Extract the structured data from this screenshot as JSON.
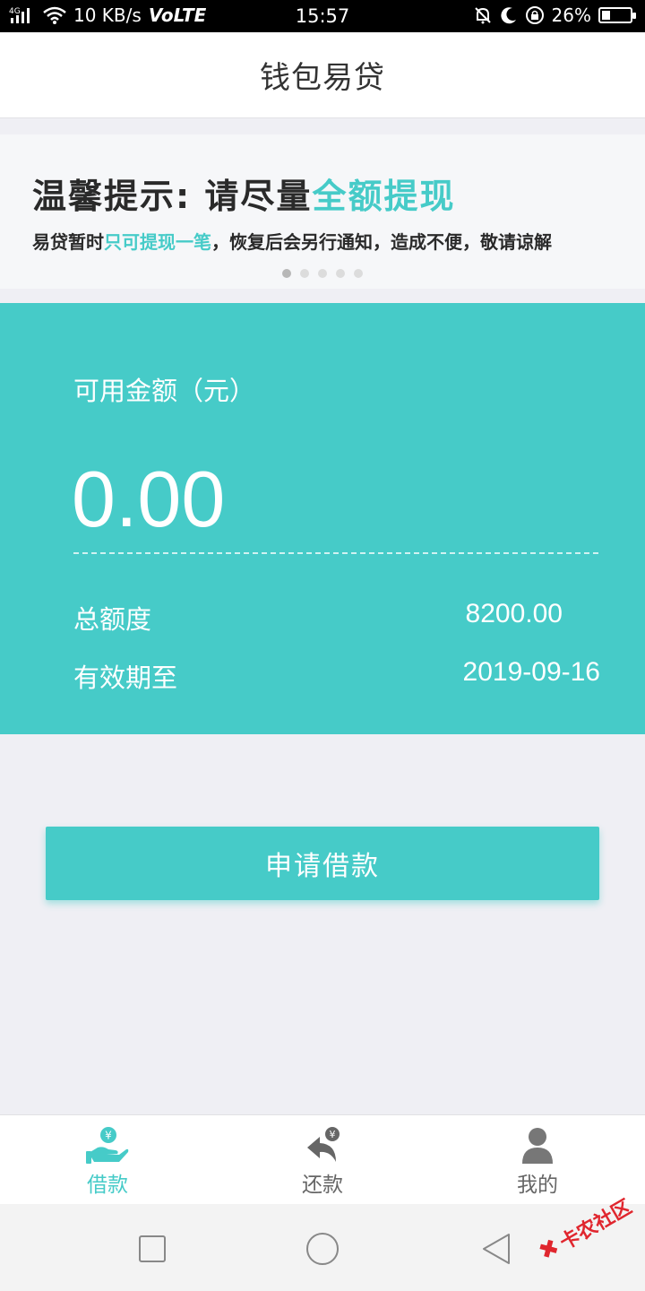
{
  "status_bar": {
    "network": "4G",
    "speed": "10 KB/s",
    "volte": "VoLTE",
    "time": "15:57",
    "battery": "26%",
    "battery_level": 0.26
  },
  "header": {
    "title": "钱包易贷"
  },
  "banner": {
    "headline_prefix": "温馨提示: 请尽量",
    "headline_highlight": "全额提现",
    "sub_prefix": "易贷暂时",
    "sub_highlight": "只可提现一笔",
    "sub_suffix": "，恢复后会另行通知，造成不便，敬请谅解",
    "dot_count": 5,
    "active_dot": 0,
    "highlight_color": "#46cbc8"
  },
  "card": {
    "available_label": "可用金额（元）",
    "available_amount": "0.00",
    "total_label": "总额度",
    "total_value": "8200.00",
    "expire_label": "有效期至",
    "expire_value": "2019-09-16",
    "color": "#46cbc8"
  },
  "apply_button": {
    "label": "申请借款"
  },
  "tabs": [
    {
      "label": "借款",
      "icon": "hand-yuan-icon",
      "active": true
    },
    {
      "label": "还款",
      "icon": "return-arrow-yuan-icon",
      "active": false
    },
    {
      "label": "我的",
      "icon": "person-icon",
      "active": false
    }
  ],
  "watermark": {
    "text": "卡农社区"
  }
}
